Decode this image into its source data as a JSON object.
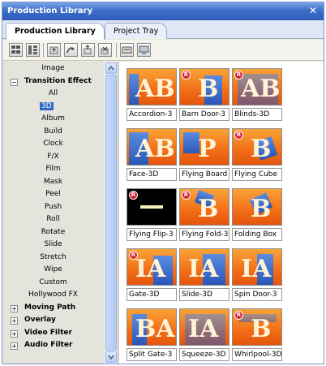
{
  "window": {
    "title": "Production Library",
    "close_glyph": "✕"
  },
  "tabs": [
    {
      "label": "Production Library",
      "active": true
    },
    {
      "label": "Project Tray",
      "active": false
    }
  ],
  "toolbar": {
    "icons": [
      "view-list-icon",
      "view-thumbnail-icon",
      "new-folder-icon",
      "import-icon",
      "export-icon",
      "delete-icon",
      "properties-icon",
      "preview-icon"
    ]
  },
  "tree": {
    "items": [
      {
        "label": "Image",
        "kind": "sub"
      },
      {
        "label": "Transition Effect",
        "kind": "cat",
        "expander": "−"
      },
      {
        "label": "All",
        "kind": "sub"
      },
      {
        "label": "3D",
        "kind": "sub",
        "selected": true
      },
      {
        "label": "Album",
        "kind": "sub"
      },
      {
        "label": "Build",
        "kind": "sub"
      },
      {
        "label": "Clock",
        "kind": "sub"
      },
      {
        "label": "F/X",
        "kind": "sub"
      },
      {
        "label": "Film",
        "kind": "sub"
      },
      {
        "label": "Mask",
        "kind": "sub"
      },
      {
        "label": "Peel",
        "kind": "sub"
      },
      {
        "label": "Push",
        "kind": "sub"
      },
      {
        "label": "Roll",
        "kind": "sub"
      },
      {
        "label": "Rotate",
        "kind": "sub"
      },
      {
        "label": "Slide",
        "kind": "sub"
      },
      {
        "label": "Stretch",
        "kind": "sub"
      },
      {
        "label": "Wipe",
        "kind": "sub"
      },
      {
        "label": "Custom",
        "kind": "sub"
      },
      {
        "label": "Hollywood FX",
        "kind": "sub"
      },
      {
        "label": "Moving Path",
        "kind": "cat",
        "expander": "+"
      },
      {
        "label": "Overlay",
        "kind": "cat",
        "expander": "+"
      },
      {
        "label": "Video Filter",
        "kind": "cat",
        "expander": "+"
      },
      {
        "label": "Audio Filter",
        "kind": "cat",
        "expander": "+"
      }
    ]
  },
  "gallery": {
    "badge_glyph": "R",
    "items": [
      {
        "label": "Accordion-3",
        "badge": false,
        "letters": "AB",
        "style": "accordion"
      },
      {
        "label": "Barn Door-3",
        "badge": true,
        "letters": "B",
        "style": "barn"
      },
      {
        "label": "Blinds-3D",
        "badge": true,
        "letters": "AB",
        "style": "blinds"
      },
      {
        "label": "Face-3D",
        "badge": false,
        "letters": "AB",
        "style": "face"
      },
      {
        "label": "Flying Board",
        "badge": false,
        "letters": "P",
        "style": "board"
      },
      {
        "label": "Flying Cube",
        "badge": true,
        "letters": "B",
        "style": "cube"
      },
      {
        "label": "Flying Flip-3",
        "badge": true,
        "letters": "",
        "style": "flip"
      },
      {
        "label": "Flying Fold-3",
        "badge": true,
        "letters": "B",
        "style": "fold"
      },
      {
        "label": "Folding Box",
        "badge": false,
        "letters": "B",
        "style": "box"
      },
      {
        "label": "Gate-3D",
        "badge": true,
        "letters": "IA",
        "style": "gate"
      },
      {
        "label": "Slide-3D",
        "badge": false,
        "letters": "IA",
        "style": "slide"
      },
      {
        "label": "Spin Door-3",
        "badge": false,
        "letters": "IA",
        "style": "spin"
      },
      {
        "label": "Split Gate-3",
        "badge": false,
        "letters": "BA",
        "style": "split"
      },
      {
        "label": "Squeeze-3D",
        "badge": false,
        "letters": "IA",
        "style": "squeeze"
      },
      {
        "label": "Whirlpool-3D",
        "badge": true,
        "letters": "B",
        "style": "whirl"
      }
    ]
  }
}
